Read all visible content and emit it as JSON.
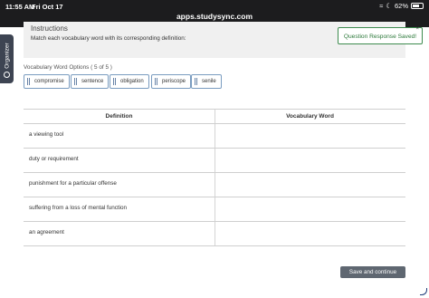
{
  "status_bar": {
    "time": "11:55 AM",
    "date": "Fri Oct 17",
    "url": "apps.studysync.com",
    "battery": "62%",
    "battery_level_percent": 62
  },
  "organizer": {
    "label": "Organizer",
    "icon": "circle-check-icon"
  },
  "instructions": {
    "title": "Instructions",
    "text": "Match each vocabulary word with its corresponding definition:"
  },
  "toast": {
    "message": "Question Response Saved!",
    "close": "×",
    "accent_color": "#2e7a3c"
  },
  "vocab_options": {
    "heading": "Vocabulary Word Options ( 5 of 5 )",
    "words": [
      "compromise",
      "sentence",
      "obligation",
      "periscope",
      "senile"
    ]
  },
  "table": {
    "headers": {
      "definition": "Definition",
      "vocab": "Vocabulary Word"
    },
    "rows": [
      {
        "definition": "a viewing tool",
        "vocab": ""
      },
      {
        "definition": "duty or requirement",
        "vocab": ""
      },
      {
        "definition": "punishment for a particular offense",
        "vocab": ""
      },
      {
        "definition": "suffering from a loss of mental function",
        "vocab": ""
      },
      {
        "definition": "an agreement",
        "vocab": ""
      }
    ]
  },
  "save_button": {
    "label": "Save and continue",
    "color": "#5f6771"
  }
}
